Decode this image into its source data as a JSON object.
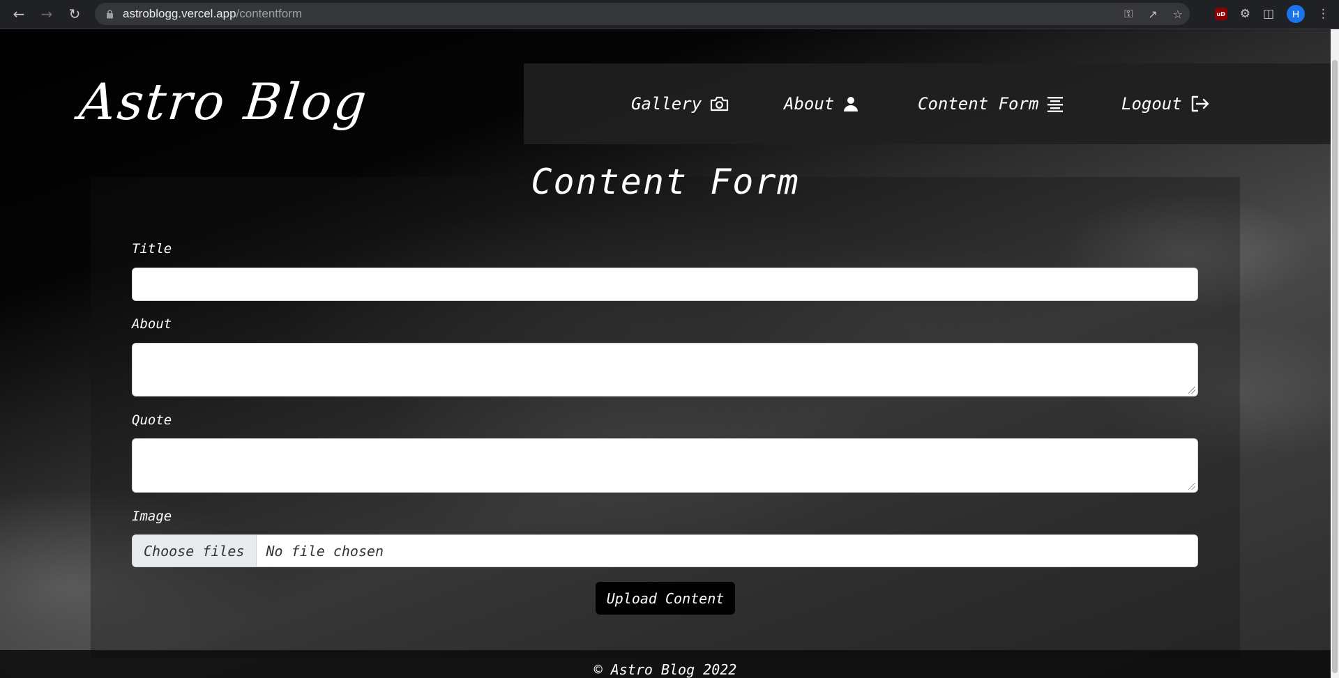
{
  "browser": {
    "url_domain": "astroblogg.vercel.app",
    "url_path": "/contentform",
    "profile_initial": "H",
    "ublock_label": "uD"
  },
  "site": {
    "logo": "Astro Blog",
    "nav": [
      {
        "label": "Gallery",
        "icon": "camera-icon"
      },
      {
        "label": "About",
        "icon": "user-icon"
      },
      {
        "label": "Content Form",
        "icon": "align-center-icon"
      },
      {
        "label": "Logout",
        "icon": "logout-icon"
      }
    ]
  },
  "form": {
    "heading": "Content Form",
    "fields": [
      {
        "label": "Title",
        "value": ""
      },
      {
        "label": "About",
        "value": ""
      },
      {
        "label": "Quote",
        "value": ""
      },
      {
        "label": "Image"
      }
    ],
    "file_button": "Choose files",
    "file_status": "No file chosen",
    "submit": "Upload Content"
  },
  "footer": {
    "text": "© Astro Blog 2022"
  }
}
